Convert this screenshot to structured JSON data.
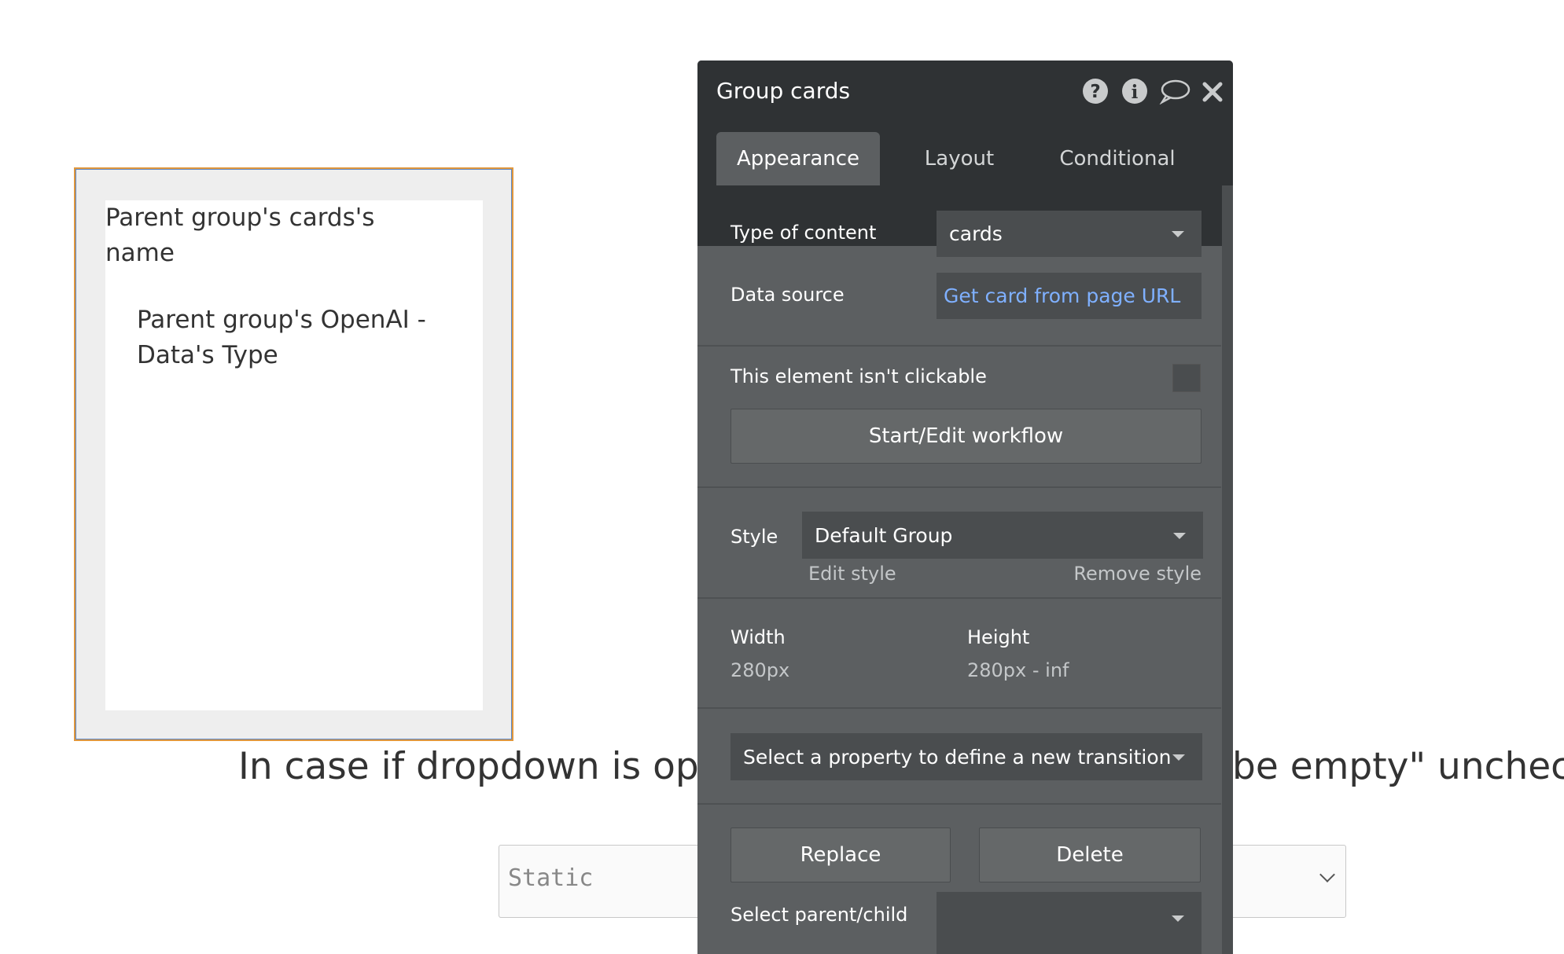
{
  "canvas": {
    "card_name_text": "Parent group's cards's name",
    "card_type_text": "Parent group's OpenAI - Data's Type",
    "visible_text_left": "In case if dropdown is opti",
    "visible_text_right": "be empty\" unchecke",
    "dropdown_value": "Static"
  },
  "editor": {
    "title": "Group cards",
    "header_icons": [
      "help-icon",
      "info-icon",
      "comment-icon",
      "close-icon"
    ],
    "tabs": [
      {
        "label": "Appearance",
        "active": true
      },
      {
        "label": "Layout",
        "active": false
      },
      {
        "label": "Conditional",
        "active": false
      }
    ],
    "type_of_content": {
      "label": "Type of content",
      "value": "cards"
    },
    "data_source": {
      "label": "Data source",
      "value": "Get card from page URL"
    },
    "not_clickable_label": "This element isn't clickable",
    "workflow_button": "Start/Edit workflow",
    "style": {
      "label": "Style",
      "value": "Default Group",
      "edit_link": "Edit style",
      "remove_link": "Remove style"
    },
    "width": {
      "label": "Width",
      "value": "280px"
    },
    "height": {
      "label": "Height",
      "value": "280px - inf"
    },
    "transition_placeholder": "Select a property to define a new transition",
    "replace_button": "Replace",
    "delete_button": "Delete",
    "parent_child_label": "Select parent/child",
    "colors": {
      "header": "#2f3234",
      "panel": "#5c5f61",
      "field": "#4a4d4f",
      "link": "#7fb0ff",
      "selection_border": "#e0973d"
    }
  }
}
